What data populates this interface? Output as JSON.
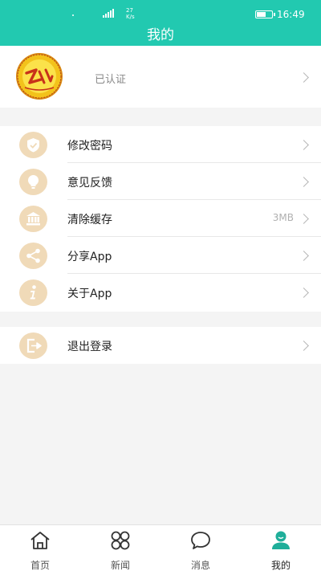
{
  "status_bar": {
    "network_speed": "27",
    "network_unit": "K/s",
    "time": "16:49"
  },
  "header": {
    "title": "我的"
  },
  "profile": {
    "status": "已认证"
  },
  "menu": [
    {
      "label": "修改密码",
      "icon": "shield-icon"
    },
    {
      "label": "意见反馈",
      "icon": "lightbulb-icon"
    },
    {
      "label": "清除缓存",
      "icon": "bank-icon",
      "value": "3MB"
    },
    {
      "label": "分享App",
      "icon": "share-icon"
    },
    {
      "label": "关于App",
      "icon": "info-icon"
    }
  ],
  "logout": {
    "label": "退出登录",
    "icon": "exit-icon"
  },
  "tabs": [
    {
      "label": "首页",
      "icon": "home-icon"
    },
    {
      "label": "新闻",
      "icon": "grid-icon"
    },
    {
      "label": "消息",
      "icon": "chat-icon"
    },
    {
      "label": "我的",
      "icon": "user-icon",
      "active": true
    }
  ],
  "colors": {
    "brand": "#22c9b0",
    "icon_bg": "#f0dab8",
    "active_tab": "#1fae9a"
  }
}
